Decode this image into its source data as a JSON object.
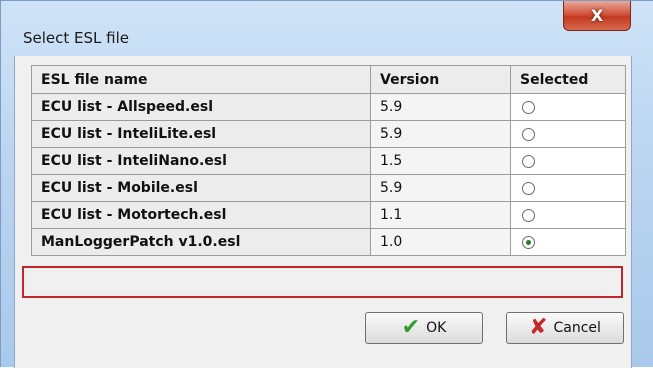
{
  "window": {
    "title": "Select ESL file",
    "close_label": "X"
  },
  "table": {
    "headers": [
      "ESL file name",
      "Version",
      "Selected"
    ],
    "rows": [
      {
        "name": "ECU list - Allspeed.esl",
        "version": "5.9",
        "selected": false
      },
      {
        "name": "ECU list - InteliLite.esl",
        "version": "5.9",
        "selected": false
      },
      {
        "name": "ECU list - InteliNano.esl",
        "version": "1.5",
        "selected": false
      },
      {
        "name": "ECU list - Mobile.esl",
        "version": "5.9",
        "selected": false
      },
      {
        "name": "ECU list - Motortech.esl",
        "version": "1.1",
        "selected": false
      },
      {
        "name": "ManLoggerPatch v1.0.esl",
        "version": "1.0",
        "selected": true
      }
    ]
  },
  "buttons": {
    "ok_label": "OK",
    "ok_icon": "checkmark-icon",
    "cancel_label": "Cancel",
    "cancel_icon": "x-cross-icon"
  },
  "colors": {
    "highlight_border": "#c0272d",
    "ok_icon": "#2e9b2e",
    "cancel_icon": "#c62828"
  }
}
